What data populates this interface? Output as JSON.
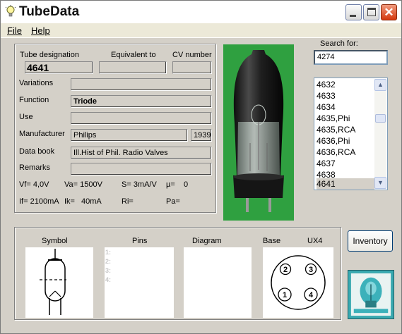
{
  "window": {
    "title": "TubeData"
  },
  "menu": {
    "file": "File",
    "help": "Help"
  },
  "fields": {
    "tube_designation": {
      "label": "Tube designation",
      "value": "4641"
    },
    "equivalent": {
      "label": "Equivalent to",
      "value": ""
    },
    "cv_number": {
      "label": "CV number",
      "value": ""
    },
    "variations": {
      "label": "Variations",
      "value": ""
    },
    "function": {
      "label": "Function",
      "value": "Triode"
    },
    "use": {
      "label": "Use",
      "value": ""
    },
    "manufacturer": {
      "label": "Manufacturer",
      "value": "Philips",
      "year": "1939"
    },
    "data_book": {
      "label": "Data book",
      "value": "Ill.Hist of Phil. Radio Valves"
    },
    "remarks": {
      "label": "Remarks",
      "value": ""
    }
  },
  "parameters": {
    "vf": "Vf= 4,0V",
    "va": "Va= 1500V",
    "s": "S= 3mA/V",
    "mu": "µ=",
    "mu_value": "0",
    "if": "If= 2100mA",
    "ik": "Ik=",
    "ik_value": "40mA",
    "ri": "Ri=",
    "pa": "Pa="
  },
  "search": {
    "label": "Search for:",
    "value": "4274"
  },
  "tube_list": {
    "items": [
      "4632",
      "4633",
      "4634",
      "4635,Phi",
      "4635,RCA",
      "4636,Phi",
      "4636,RCA",
      "4637",
      "4638",
      "4641"
    ],
    "selected": "4641"
  },
  "bottom": {
    "symbol": "Symbol",
    "pins": "Pins",
    "diagram": "Diagram",
    "base": "Base",
    "base_type": "UX4",
    "pin_numbers": [
      "1:",
      "2:",
      "3:",
      "4:"
    ],
    "base_pins": [
      "2",
      "3",
      "1",
      "4"
    ]
  },
  "buttons": {
    "inventory": "Inventory"
  },
  "colors": {
    "photo_bg": "#2fa040",
    "logo_bg": "#39a9b0",
    "selection": "#d4d0c8"
  }
}
